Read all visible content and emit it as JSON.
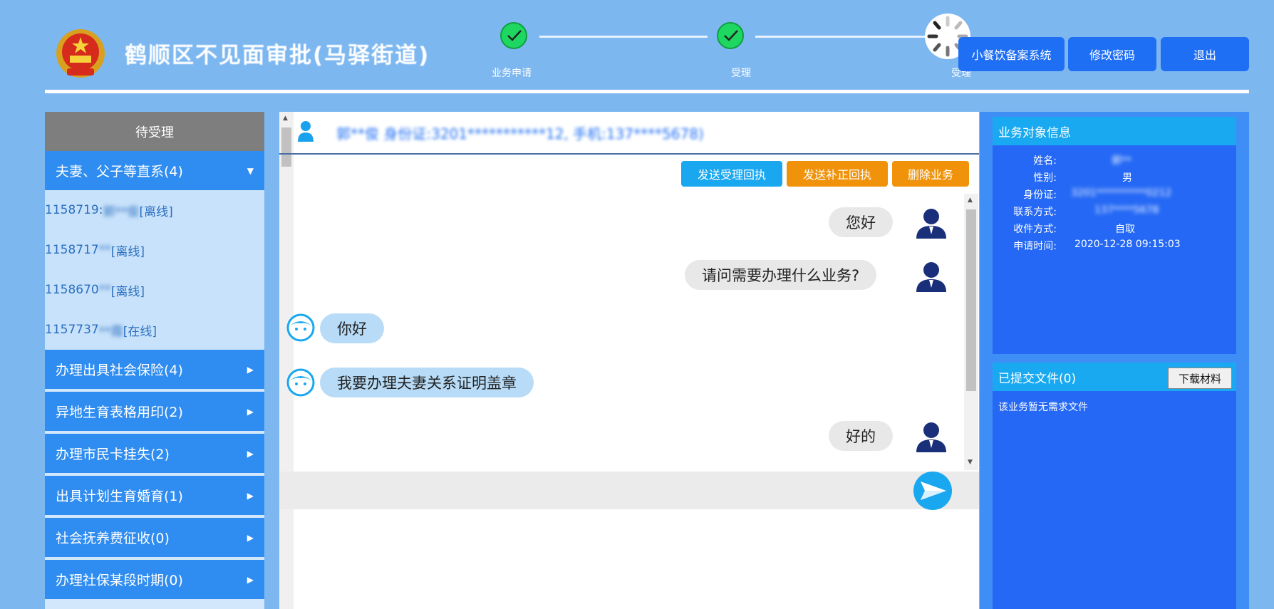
{
  "header": {
    "title": "鹤顺区不见面审批(马驿街道)",
    "steps": [
      {
        "label": "业务申请",
        "status": "done"
      },
      {
        "label": "受理",
        "status": "done"
      },
      {
        "label": "受理",
        "status": "in-progress"
      }
    ],
    "buttons": {
      "small_catering": "小餐饮备案系统",
      "change_password": "修改密码",
      "logout": "退出"
    }
  },
  "sidebar": {
    "title": "待受理",
    "groups": [
      {
        "label": "夫妻、父子等直系(4)",
        "expanded": true,
        "items": [
          {
            "id": "1158719:",
            "name": "郭**俊",
            "status": "[离线]"
          },
          {
            "id": "1158717",
            "name": "**",
            "status": "[离线]"
          },
          {
            "id": "1158670",
            "name": "**",
            "status": "[离线]"
          },
          {
            "id": "1157737",
            "name": "**霞",
            "status": "[在线]"
          }
        ]
      },
      {
        "label": "办理出具社会保险(4)",
        "expanded": false
      },
      {
        "label": "异地生育表格用印(2)",
        "expanded": false
      },
      {
        "label": "办理市民卡挂失(2)",
        "expanded": false
      },
      {
        "label": "出具计划生育婚育(1)",
        "expanded": false
      },
      {
        "label": "社会抚养费征收(0)",
        "expanded": false
      },
      {
        "label": "办理社保某段时期(0)",
        "expanded": false
      }
    ]
  },
  "chat": {
    "header_text": "郭**俊 身份证:3201***********12, 手机:137****5678)",
    "actions": {
      "send_accept_receipt": "发送受理回执",
      "send_supplement_receipt": "发送补正回执",
      "delete_business": "删除业务"
    },
    "messages": [
      {
        "sender": "agent",
        "text": "您好"
      },
      {
        "sender": "agent",
        "text": "请问需要办理什么业务?"
      },
      {
        "sender": "user",
        "text": "你好"
      },
      {
        "sender": "user",
        "text": "我要办理夫妻关系证明盖章"
      },
      {
        "sender": "agent",
        "text": "好的"
      }
    ],
    "input_value": ""
  },
  "info": {
    "title": "业务对象信息",
    "fields": [
      {
        "label": "姓名:",
        "value": "郭**"
      },
      {
        "label": "性别:",
        "value": "男"
      },
      {
        "label": "身份证:",
        "value": "3201**********0212"
      },
      {
        "label": "联系方式:",
        "value": "137****5678"
      },
      {
        "label": "收件方式:",
        "value": "自取"
      },
      {
        "label": "申请时间:",
        "value": "2020-12-28 09:15:03"
      }
    ]
  },
  "files": {
    "title": "已提交文件(0)",
    "download_label": "下载材料",
    "empty_text": "该业务暂无需求文件"
  },
  "colors": {
    "page_bg": "#7db7f0",
    "primary_btn": "#1f6ff5",
    "cyan_btn": "#19a7f0",
    "orange_btn": "#f0930a",
    "step_done": "#1ed760"
  }
}
